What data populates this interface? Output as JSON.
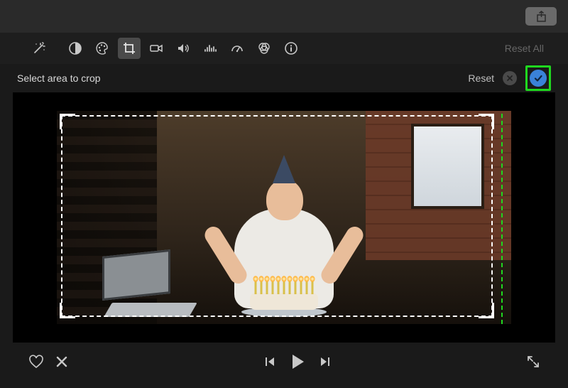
{
  "topbar": {
    "share_icon": "share-icon"
  },
  "toolbar": {
    "magic_wand": "magic-wand-icon",
    "color_balance": "color-balance-icon",
    "color_palette": "color-palette-icon",
    "crop": "crop-icon",
    "stabilize": "video-camera-icon",
    "volume": "volume-icon",
    "equalizer": "audio-equalizer-icon",
    "speed": "speedometer-icon",
    "color_filter": "color-filter-icon",
    "info": "info-icon",
    "reset_all_label": "Reset All",
    "active_tool": "crop"
  },
  "subbar": {
    "instruction": "Select area to crop",
    "reset_label": "Reset",
    "cancel_icon": "cancel-icon",
    "apply_icon": "checkmark-icon"
  },
  "preview": {
    "crop_highlight_color": "#1fd81f",
    "apply_highlight_color": "#1fd81f"
  },
  "bottombar": {
    "favorite_icon": "heart-icon",
    "reject_icon": "x-icon",
    "prev_icon": "skip-back-icon",
    "play_icon": "play-icon",
    "next_icon": "skip-forward-icon",
    "fullscreen_icon": "fullscreen-icon"
  }
}
